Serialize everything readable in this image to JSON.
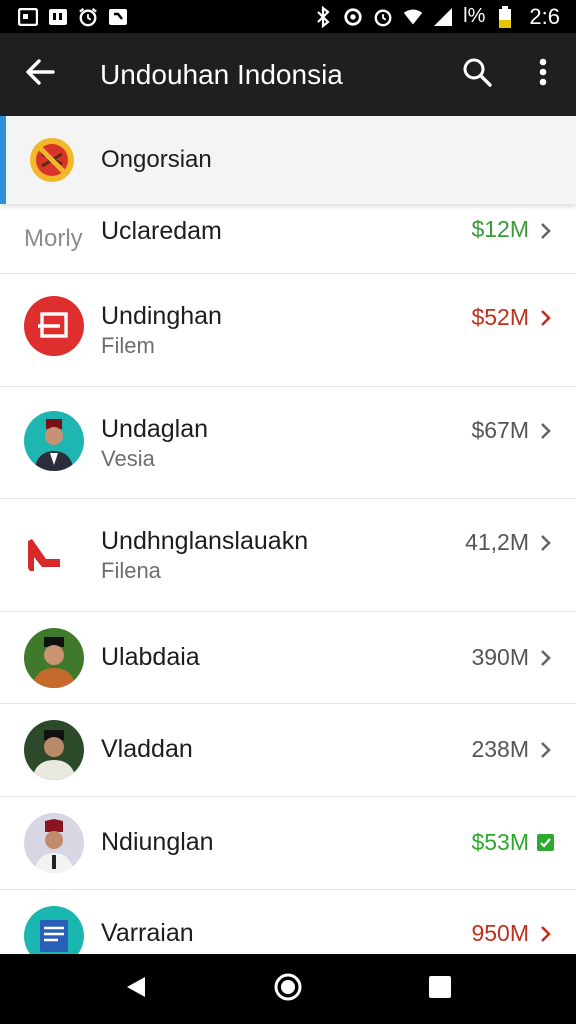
{
  "status_bar": {
    "battery_text": "l%",
    "time": "2:6",
    "left_icons": [
      "screenshot-icon",
      "notification-icon",
      "alarm-icon",
      "download-icon"
    ],
    "right_icons": [
      "bluetooth-icon",
      "sync-icon",
      "alarm-icon",
      "wifi-icon",
      "signal-icon",
      "battery-icon"
    ]
  },
  "app_bar": {
    "title": "Undouhan Indonsia",
    "back_icon": "back-arrow-icon",
    "search_icon": "search-icon",
    "menu_icon": "more-vert-icon"
  },
  "featured": {
    "label": "Ongorsian",
    "icon": "blocked-icon"
  },
  "list": {
    "items": [
      {
        "prefix": "Morly",
        "title": "Uclaredam",
        "subtitle": "",
        "size": "$12M",
        "size_color": "#3a9a3a",
        "chevron": "chevron-right-icon"
      },
      {
        "title": "Undinghan",
        "subtitle": "Filem",
        "size": "$52M",
        "size_color": "#c0301e",
        "chevron": "chevron-right-icon",
        "avatar": "red-app-icon"
      },
      {
        "title": "Undaglan",
        "subtitle": "Vesia",
        "size": "$67M",
        "size_color": "#555555",
        "chevron": "chevron-right-icon",
        "avatar": "person-avatar"
      },
      {
        "title": "Undhnglanslauakn",
        "subtitle": "Filena",
        "size": "41,2M",
        "size_color": "#555555",
        "chevron": "chevron-right-icon",
        "avatar": "red-logo-icon"
      },
      {
        "title": "Ulabdaia",
        "subtitle": "",
        "size": "390M",
        "size_color": "#555555",
        "chevron": "chevron-right-icon",
        "avatar": "person-avatar"
      },
      {
        "title": "Vladdan",
        "subtitle": "",
        "size": "238M",
        "size_color": "#555555",
        "chevron": "chevron-right-icon",
        "avatar": "person-avatar"
      },
      {
        "title": "Ndiunglan",
        "subtitle": "",
        "size": "$53M",
        "size_color": "#2ea82e",
        "chevron": "check-box-icon",
        "avatar": "person-avatar"
      },
      {
        "title": "Varraian",
        "subtitle": "",
        "size": "950M",
        "size_color": "#c0301e",
        "chevron": "chevron-right-icon",
        "avatar": "document-app-icon"
      }
    ]
  },
  "nav_bar": {
    "back": "nav-back-icon",
    "home": "nav-home-icon",
    "recents": "nav-recents-icon"
  }
}
